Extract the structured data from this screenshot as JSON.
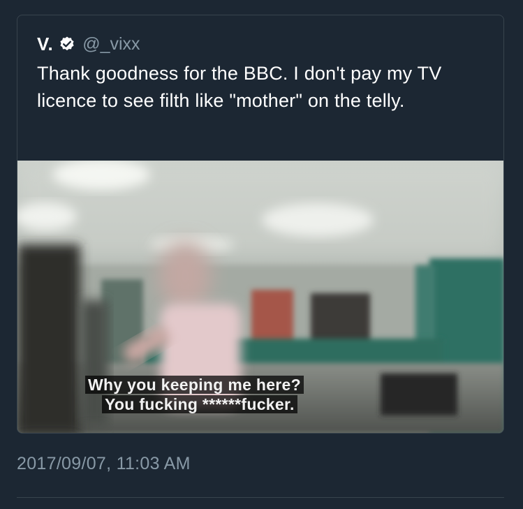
{
  "quoted_tweet": {
    "author_name": "V.",
    "verified": true,
    "handle": "@_vixx",
    "text": "Thank goodness for the BBC. I don't pay my TV licence to see filth like \"mother\" on the telly.",
    "media": {
      "subtitle_line_1": "Why you keeping me here?",
      "subtitle_line_2": "You fucking ******fucker."
    }
  },
  "timestamp": "2017/09/07, 11:03 AM",
  "colors": {
    "background": "#1c2733",
    "border": "#38444d",
    "text_primary": "#ffffff",
    "text_secondary": "#8899a6",
    "verified_badge": "#ffffff"
  },
  "icons": {
    "verified": "verified-badge-icon"
  }
}
